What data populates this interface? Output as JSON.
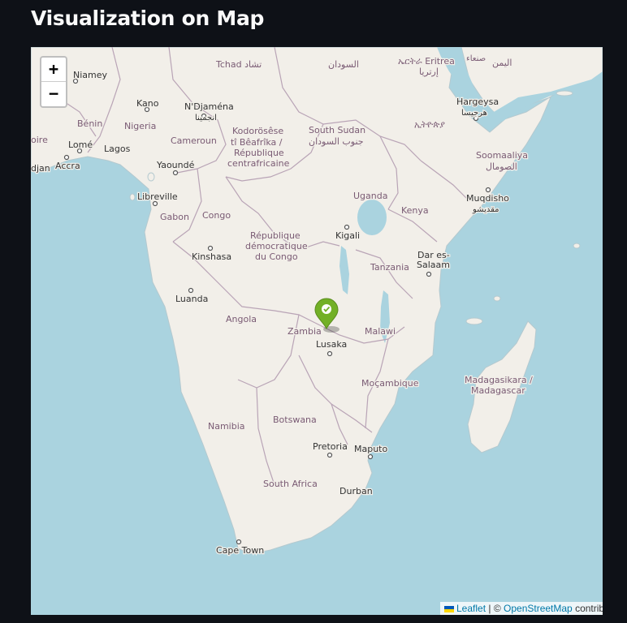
{
  "page": {
    "title": "Visualization on Map"
  },
  "map": {
    "zoom_in_label": "+",
    "zoom_out_label": "−",
    "marker": {
      "icon": "check-circle-icon",
      "color": "#72b026"
    },
    "country_labels": [
      "Tchad تشاد",
      "السودان",
      "ኤርትራ Eritrea",
      "إرتريا",
      "صنعاء",
      "اليمن",
      "Niamey",
      "Kano",
      "N'Djaména",
      "انجمينا",
      "Bénin",
      "Nigeria",
      "Kodorösêse",
      "tî Bêafrîka /",
      "République",
      "centrafricaine",
      "South Sudan",
      "جنوب السودان",
      "ኢትዮጵያ",
      "Hargeysa",
      "هرجيسا",
      "Lomé",
      "Lagos",
      "Cameroun",
      "Accra",
      "Yaoundé",
      "Soomaaliya",
      "الصومال",
      "Libreville",
      "Gabon",
      "Congo",
      "Uganda",
      "Muqdisho",
      "مقديشو",
      "Kenya",
      "République",
      "démocratique",
      "du Congo",
      "Kigali",
      "Kinshasa",
      "Tanzania",
      "Dar es-",
      "Salaam",
      "Luanda",
      "Angola",
      "Zambia",
      "Malawi",
      "Lusaka",
      "Moçambique",
      "Madagasikara /",
      "Madagascar",
      "Namibia",
      "Botswana",
      "Pretoria",
      "Maputo",
      "South Africa",
      "Durban",
      "Cape Town",
      "oire",
      "djan",
      "na"
    ],
    "attribution": {
      "leaflet": "Leaflet",
      "separator": "| ©",
      "osm": "OpenStreetMap",
      "contrib": "contributors"
    }
  },
  "colors": {
    "background": "#0e1117",
    "water": "#aad3df",
    "land": "#f2efe9",
    "border": "#9e8fa0",
    "marker": "#72b026"
  }
}
